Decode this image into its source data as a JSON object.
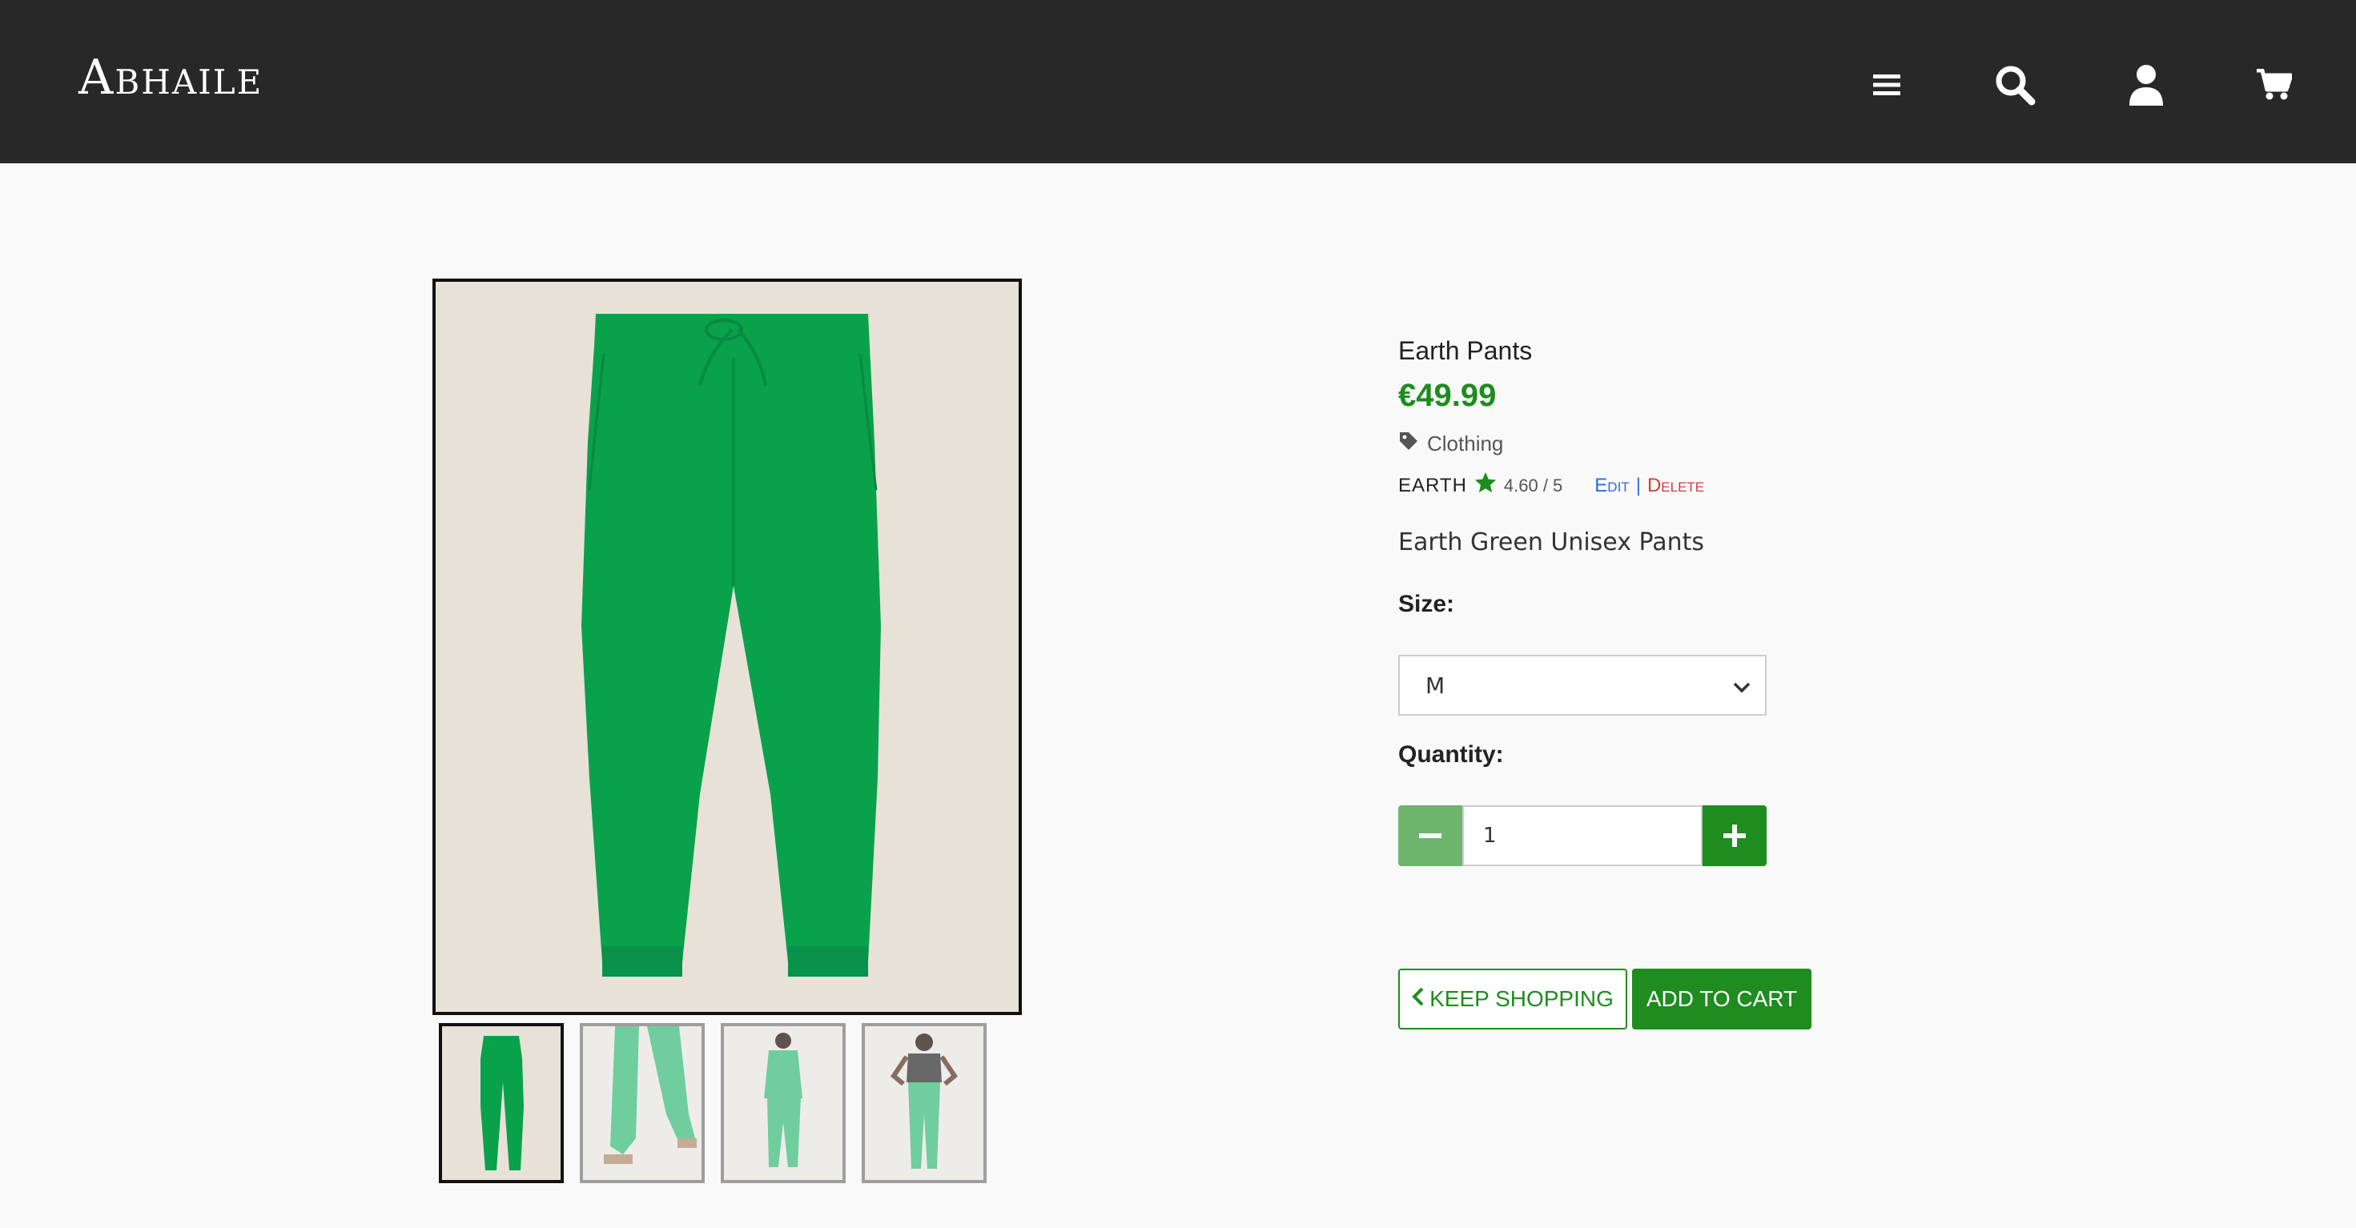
{
  "header": {
    "brand": "Abhaile",
    "icons": [
      "menu-icon",
      "search-icon",
      "user-icon",
      "cart-icon"
    ]
  },
  "product": {
    "name": "Earth Pants",
    "price": "€49.99",
    "category": "Clothing",
    "brand": "EARTH",
    "rating": "4.60 / 5",
    "edit_label": "Edit",
    "separator": "|",
    "delete_label": "Delete",
    "description": "Earth Green Unisex Pants",
    "size_label": "Size:",
    "size_value": "M",
    "quantity_label": "Quantity:",
    "quantity_value": "1"
  },
  "buttons": {
    "keep_shopping": "KEEP SHOPPING",
    "add_to_cart": "ADD TO CART"
  },
  "gallery": {
    "thumbnail_count": 4,
    "active_index": 0
  },
  "colors": {
    "header_bg": "#282828",
    "accent_green": "#1e8c1e",
    "minus_green": "#6db56d",
    "product_green": "#0aa14b",
    "edit_blue": "#2a6fd6",
    "delete_red": "#d43a3a"
  }
}
